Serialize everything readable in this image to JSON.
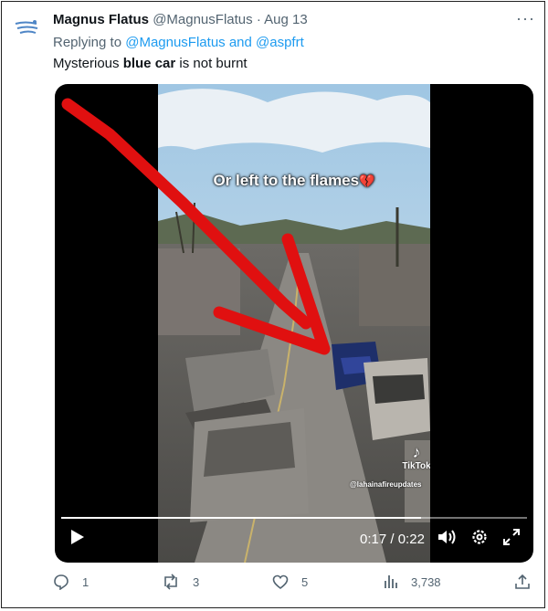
{
  "tweet": {
    "author_name": "Magnus Flatus",
    "handle": "@MagnusFlatus",
    "separator": "·",
    "date": "Aug 13",
    "reply_prefix": "Replying to",
    "reply_to_text": "@MagnusFlatus and @aspfrt",
    "text_before": "Mysterious ",
    "text_bold": "blue car",
    "text_after": " is not burnt"
  },
  "video": {
    "caption": "Or left to the flames",
    "caption_emoji": "💔",
    "tiktok_label": "TikTok",
    "watermark": "@lahainafireupdates",
    "current_time": "0:17",
    "time_separator": "/",
    "duration": "0:22",
    "progress_fraction": 0.773
  },
  "actions": {
    "replies": "1",
    "retweets": "3",
    "likes": "5",
    "views": "3,738"
  },
  "icons": [
    "bird-logo-icon",
    "more-icon",
    "play-icon",
    "volume-icon",
    "settings-icon",
    "fullscreen-icon",
    "reply-icon",
    "retweet-icon",
    "like-icon",
    "views-icon",
    "share-icon",
    "tiktok-icon"
  ],
  "colors": {
    "link": "#1d9bf0",
    "muted": "#536471",
    "arrow": "#e01010",
    "heart": "#e0244a"
  }
}
